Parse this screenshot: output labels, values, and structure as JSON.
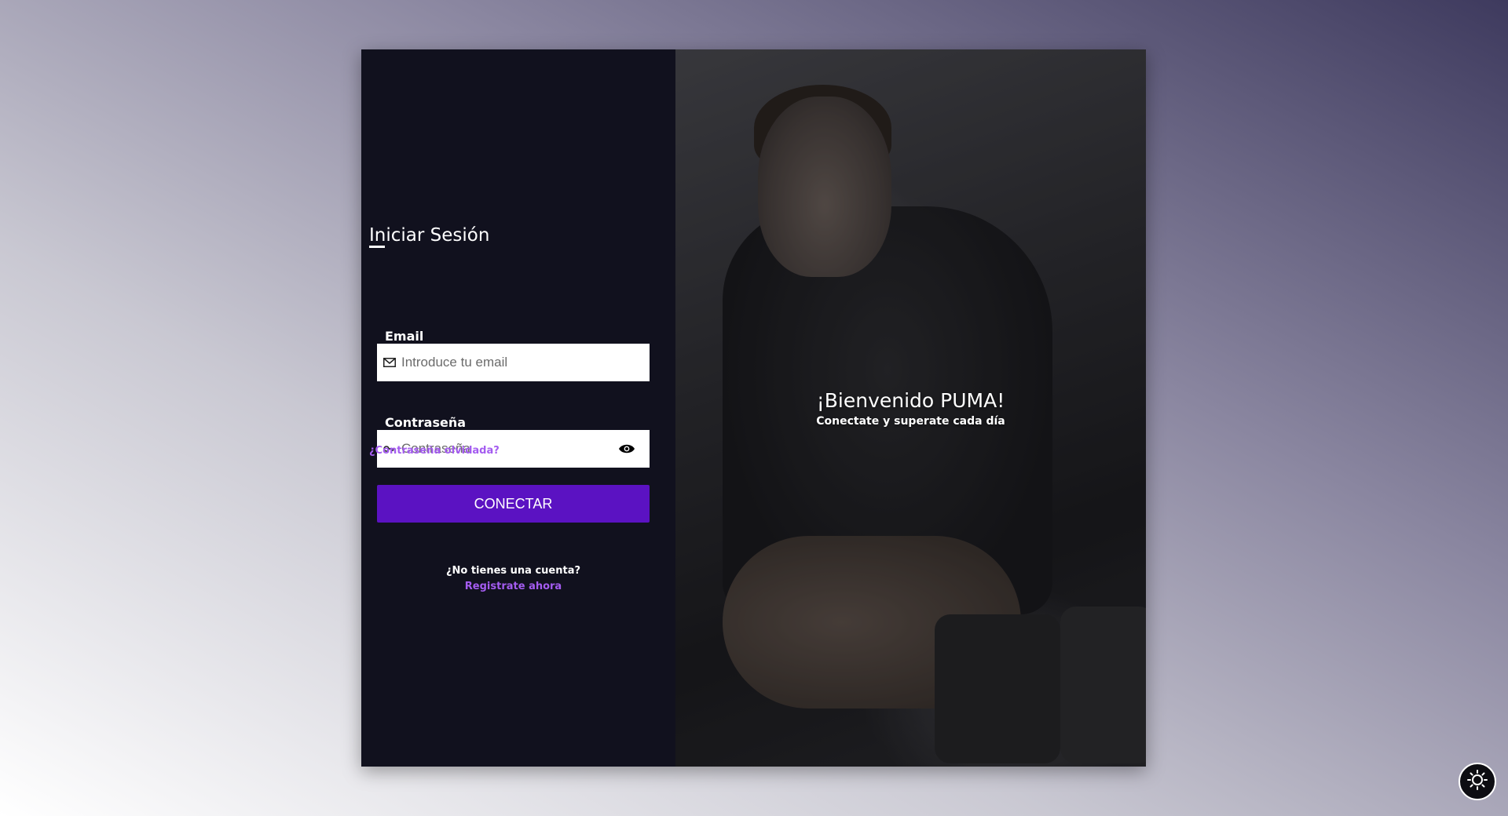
{
  "login": {
    "title": "Iniciar Sesión",
    "email_label": "Email",
    "email_placeholder": "Introduce tu email",
    "email_value": "",
    "password_label": "Contraseña",
    "password_placeholder": "Contraseña",
    "password_value": "",
    "forgot_link": "¿Contraseña olvidada?",
    "submit_label": "CONECTAR",
    "no_account_text": "¿No tienes una cuenta?",
    "register_link": "Registrate ahora"
  },
  "hero": {
    "welcome": "¡Bienvenido PUMA!",
    "subtitle": "Conectate y superate cada día"
  },
  "icons": {
    "email": "envelope-icon",
    "password": "key-icon",
    "toggle_password": "eye-icon",
    "theme": "sun-icon"
  },
  "colors": {
    "panel_bg": "#11111e",
    "accent": "#5b12c2",
    "link": "#a45cf0"
  }
}
